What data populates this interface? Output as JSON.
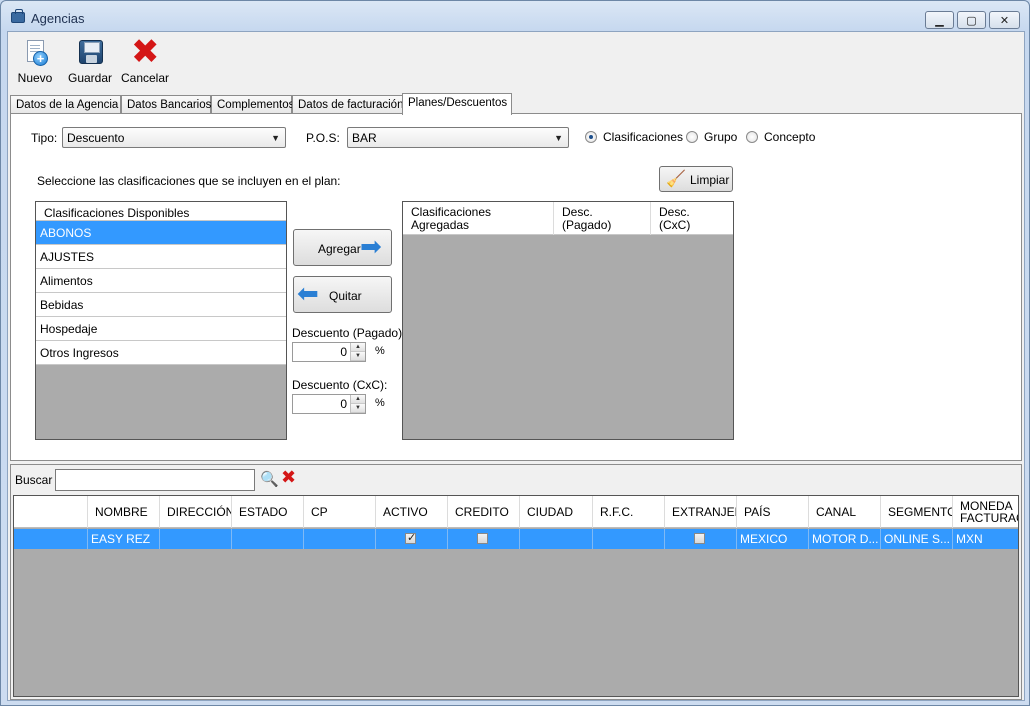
{
  "window": {
    "title": "Agencias"
  },
  "toolbar": {
    "new_label": "Nuevo",
    "save_label": "Guardar",
    "cancel_label": "Cancelar"
  },
  "tabs": [
    {
      "label": "Datos de la Agencia"
    },
    {
      "label": "Datos Bancarios"
    },
    {
      "label": "Complementos"
    },
    {
      "label": "Datos de facturación"
    },
    {
      "label": "Planes/Descuentos"
    }
  ],
  "form": {
    "tipo_label": "Tipo:",
    "tipo_value": "Descuento",
    "pos_label": "P.O.S:",
    "pos_value": "BAR",
    "radios": [
      {
        "label": "Clasificaciones",
        "checked": true
      },
      {
        "label": "Grupo",
        "checked": false
      },
      {
        "label": "Concepto",
        "checked": false
      }
    ],
    "instructions": "Seleccione las clasificaciones que se incluyen en el plan:",
    "clear_label": "Limpiar",
    "available_header": "Clasificaciones Disponibles",
    "available_items": [
      "ABONOS",
      "AJUSTES",
      "Alimentos",
      "Bebidas",
      "Hospedaje",
      "Otros Ingresos"
    ],
    "selected_index": 0,
    "add_label": "Agregar",
    "remove_label": "Quitar",
    "disc_paid_label": "Descuento (Pagado):",
    "disc_paid_value": "0",
    "disc_cxc_label": "Descuento (CxC):",
    "disc_cxc_value": "0",
    "percent": "%",
    "added_headers": [
      {
        "l1": "Clasificaciones",
        "l2": "Agregadas"
      },
      {
        "l1": "Desc.",
        "l2": "(Pagado)"
      },
      {
        "l1": "Desc.",
        "l2": "(CxC)"
      }
    ]
  },
  "search": {
    "label": "Buscar",
    "value": ""
  },
  "grid": {
    "columns": [
      "",
      "NOMBRE",
      "DIRECCIÓN",
      "ESTADO",
      "CP",
      "ACTIVO",
      "CREDITO",
      "CIUDAD",
      "R.F.C.",
      "EXTRANJERO",
      "PAÍS",
      "CANAL",
      "SEGMENTO",
      "MONEDA FACTURACION"
    ],
    "moneda_l1": "MONEDA",
    "moneda_l2": "FACTURACION",
    "rows": [
      {
        "nombre": "EASY REZ",
        "direccion": "",
        "estado": "",
        "cp": "",
        "activo": true,
        "credito": false,
        "ciudad": "",
        "rfc": "",
        "extranjero": false,
        "pais": "MEXICO",
        "canal": "MOTOR D...",
        "segmento": "ONLINE S...",
        "moneda": "MXN"
      }
    ]
  }
}
